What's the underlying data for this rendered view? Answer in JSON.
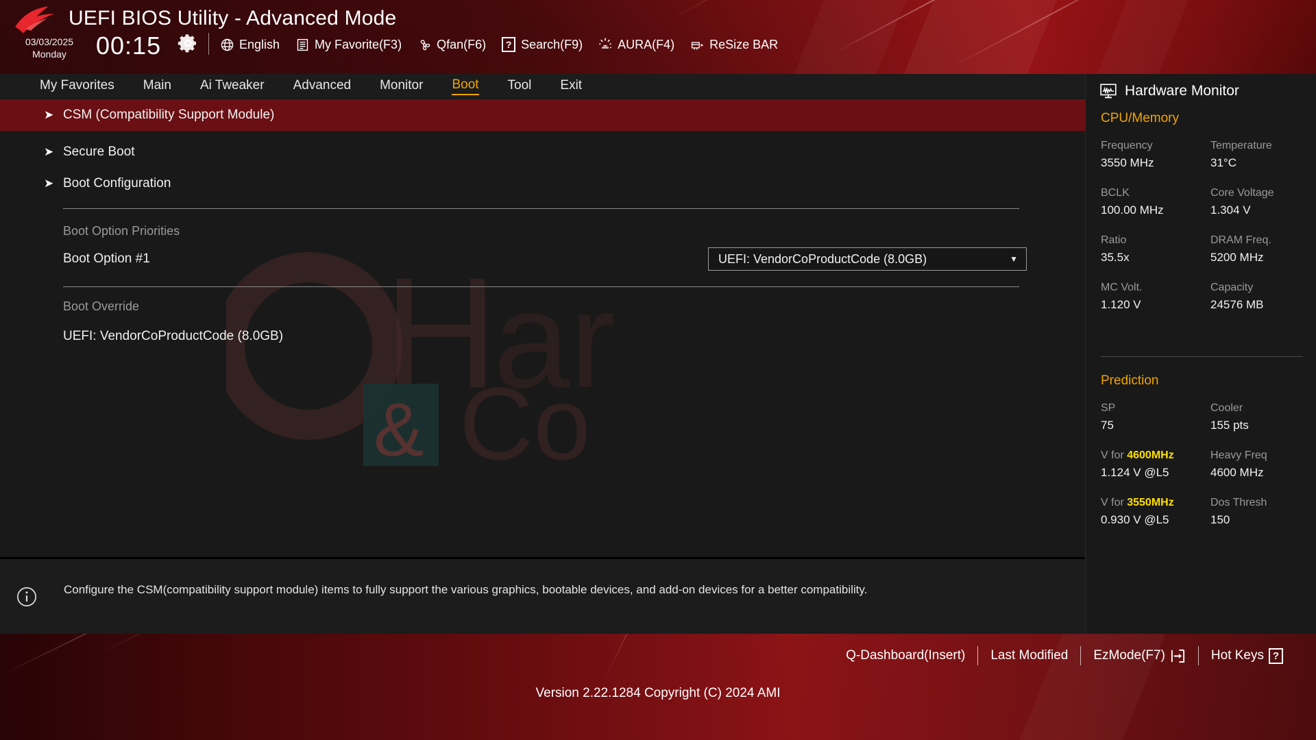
{
  "header": {
    "title": "UEFI BIOS Utility - Advanced Mode",
    "date": "03/03/2025",
    "weekday": "Monday",
    "time": "00:15",
    "gear_icon": "gear-icon",
    "tools": [
      {
        "label": "English",
        "icon": "globe-icon"
      },
      {
        "label": "My Favorite(F3)",
        "icon": "list-document-icon"
      },
      {
        "label": "Qfan(F6)",
        "icon": "fan-icon"
      },
      {
        "label": "Search(F9)",
        "icon": "question-box-icon"
      },
      {
        "label": "AURA(F4)",
        "icon": "aura-lighting-icon"
      },
      {
        "label": "ReSize BAR",
        "icon": "resize-bar-icon"
      }
    ]
  },
  "nav": {
    "items": [
      {
        "label": "My Favorites",
        "active": false
      },
      {
        "label": "Main",
        "active": false
      },
      {
        "label": "Ai Tweaker",
        "active": false
      },
      {
        "label": "Advanced",
        "active": false
      },
      {
        "label": "Monitor",
        "active": false
      },
      {
        "label": "Boot",
        "active": true
      },
      {
        "label": "Tool",
        "active": false
      },
      {
        "label": "Exit",
        "active": false
      }
    ]
  },
  "main": {
    "menu_items": [
      {
        "label": "CSM (Compatibility Support Module)",
        "selected": true
      },
      {
        "label": "Secure Boot",
        "selected": false
      },
      {
        "label": "Boot Configuration",
        "selected": false
      }
    ],
    "boot_priorities_heading": "Boot Option Priorities",
    "boot_option_label": "Boot Option #1",
    "boot_option_value": "UEFI: VendorCoProductCode (8.0GB)",
    "boot_override_heading": "Boot Override",
    "boot_override_item": "UEFI: VendorCoProductCode (8.0GB)"
  },
  "description": {
    "icon": "info-icon",
    "text": "Configure the CSM(compatibility support module) items to fully support the various graphics, bootable devices, and add-on devices for a better compatibility."
  },
  "hardware_monitor": {
    "title": "Hardware Monitor",
    "icon": "monitor-waveform-icon",
    "sections": [
      {
        "name": "CPU/Memory",
        "pairs": [
          {
            "left_key": "Frequency",
            "left_val": "3550 MHz",
            "right_key": "Temperature",
            "right_val": "31°C"
          },
          {
            "left_key": "BCLK",
            "left_val": "100.00 MHz",
            "right_key": "Core Voltage",
            "right_val": "1.304 V"
          },
          {
            "left_key": "Ratio",
            "left_val": "35.5x",
            "right_key": "DRAM Freq.",
            "right_val": "5200 MHz"
          },
          {
            "left_key": "MC Volt.",
            "left_val": "1.120 V",
            "right_key": "Capacity",
            "right_val": "24576 MB"
          }
        ]
      },
      {
        "name": "Prediction",
        "pairs": [
          {
            "left_key": "SP",
            "left_val": "75",
            "right_key": "Cooler",
            "right_val": "155 pts"
          },
          {
            "left_key_pre": "V for ",
            "left_key_hi": "4600MHz",
            "left_val": "1.124 V @L5",
            "right_key": "Heavy Freq",
            "right_val": "4600 MHz"
          },
          {
            "left_key_pre": "V for ",
            "left_key_hi": "3550MHz",
            "left_val": "0.930 V @L5",
            "right_key": "Dos Thresh",
            "right_val": "150"
          }
        ]
      }
    ]
  },
  "footer": {
    "links": [
      {
        "label": "Q-Dashboard(Insert)",
        "icon": ""
      },
      {
        "label": "Last Modified",
        "icon": ""
      },
      {
        "label": "EzMode(F7)",
        "icon": "exit-arrow-icon"
      },
      {
        "label": "Hot Keys",
        "icon": "question-box-icon"
      }
    ],
    "version": "Version 2.22.1284 Copyright (C) 2024 AMI"
  },
  "colors": {
    "accent_amber": "#f0a500",
    "highlight_yellow": "#ffe100",
    "selection_red": "#6a1015",
    "panel_bg": "#191919"
  }
}
